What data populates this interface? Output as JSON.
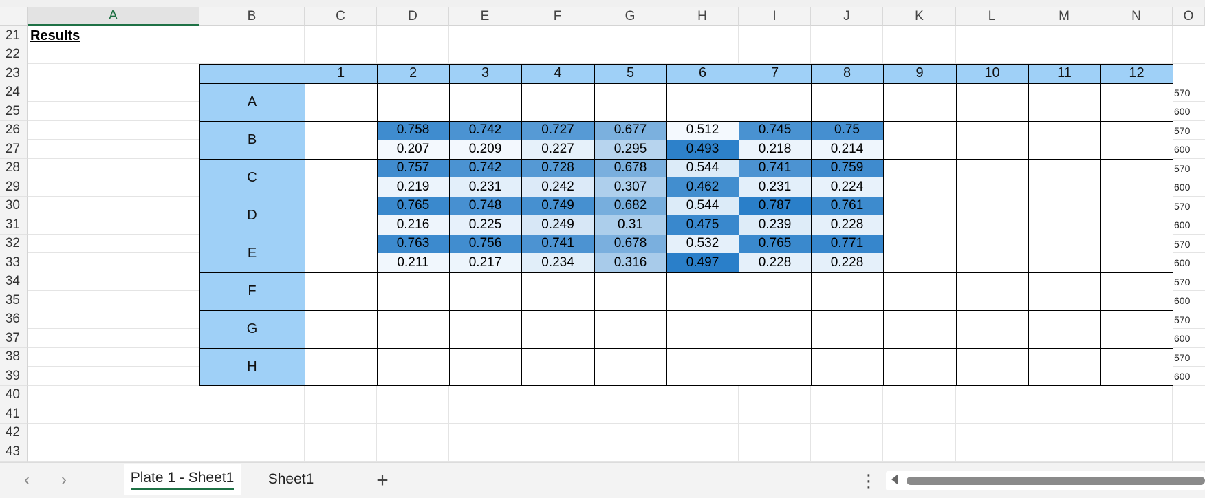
{
  "columns": [
    "A",
    "B",
    "C",
    "D",
    "E",
    "F",
    "G",
    "H",
    "I",
    "J",
    "K",
    "L",
    "M",
    "N",
    "O"
  ],
  "selected_column": "A",
  "rows": [
    "21",
    "22",
    "23",
    "24",
    "25",
    "26",
    "27",
    "28",
    "29",
    "30",
    "31",
    "32",
    "33",
    "34",
    "35",
    "36",
    "37",
    "38",
    "39",
    "40",
    "41",
    "42",
    "43"
  ],
  "results_label": "Results",
  "plate": {
    "col_labels": [
      "1",
      "2",
      "3",
      "4",
      "5",
      "6",
      "7",
      "8",
      "9",
      "10",
      "11",
      "12"
    ],
    "row_labels": [
      "A",
      "B",
      "C",
      "D",
      "E",
      "F",
      "G",
      "H"
    ],
    "wavelengths": [
      "570",
      "600"
    ],
    "data": {
      "B": [
        [
          "0.758",
          "0.742",
          "0.727",
          "0.677",
          "0.512",
          "0.745",
          "0.75"
        ],
        [
          "0.207",
          "0.209",
          "0.227",
          "0.295",
          "0.493",
          "0.218",
          "0.214"
        ]
      ],
      "C": [
        [
          "0.757",
          "0.742",
          "0.728",
          "0.678",
          "0.544",
          "0.741",
          "0.759"
        ],
        [
          "0.219",
          "0.231",
          "0.242",
          "0.307",
          "0.462",
          "0.231",
          "0.224"
        ]
      ],
      "D": [
        [
          "0.765",
          "0.748",
          "0.749",
          "0.682",
          "0.544",
          "0.787",
          "0.761"
        ],
        [
          "0.216",
          "0.225",
          "0.249",
          "0.31",
          "0.475",
          "0.239",
          "0.228"
        ]
      ],
      "E": [
        [
          "0.763",
          "0.756",
          "0.741",
          "0.678",
          "0.532",
          "0.765",
          "0.771"
        ],
        [
          "0.211",
          "0.217",
          "0.234",
          "0.316",
          "0.497",
          "0.228",
          "0.228"
        ]
      ]
    },
    "heat_colors": {
      "low": "#f4f9fe",
      "high": "#2a7fc9",
      "header": "#9fd0f7"
    }
  },
  "tabs": [
    {
      "label": "Plate 1 - Sheet1",
      "active": true
    },
    {
      "label": "Sheet1",
      "active": false
    }
  ],
  "nav_icons": {
    "prev": "chevron-left-icon",
    "next": "chevron-right-icon",
    "add": "plus-icon",
    "more": "more-vertical-icon"
  }
}
